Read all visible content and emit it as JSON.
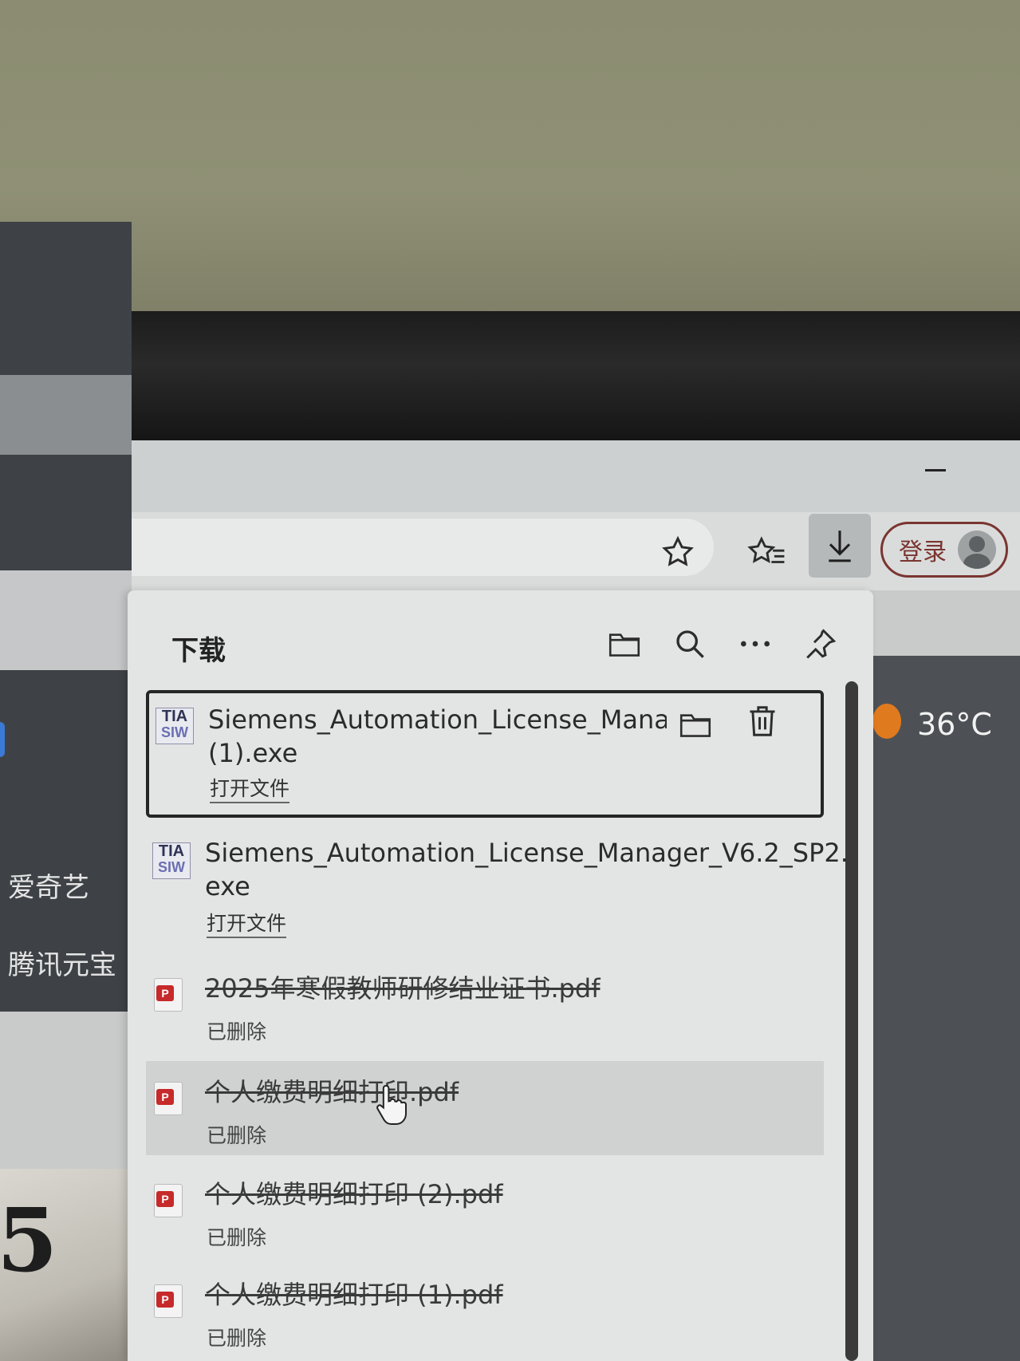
{
  "browser": {
    "login_label": "登录",
    "icons": [
      "star-icon",
      "favorites-list-icon",
      "download-icon",
      "avatar-icon",
      "minimize-icon"
    ]
  },
  "page_background": {
    "side_items": [
      "爱奇艺",
      "腾讯元宝"
    ],
    "weather_temp": "36°C",
    "poster_text": "5"
  },
  "downloads": {
    "title": "下载",
    "header_icons": [
      "folder-icon",
      "search-icon",
      "more-icon",
      "pin-icon"
    ],
    "items": [
      {
        "name_line1": "Siemens_Automation_License_Manager_V",
        "name_line2": "(1).exe",
        "action": "打开文件",
        "icon_top": "TIA",
        "icon_bottom": "SIW",
        "deleted": false,
        "selected": true
      },
      {
        "name_line1": "Siemens_Automation_License_Manager_V6.2_SP2.",
        "name_line2": "exe",
        "action": "打开文件",
        "icon_top": "TIA",
        "icon_bottom": "SIW",
        "deleted": false
      },
      {
        "name_line1": "2025年寒假教师研修结业证书.pdf",
        "status": "已删除",
        "deleted": true
      },
      {
        "name_line1": "个人缴费明细打印.pdf",
        "status": "已删除",
        "deleted": true,
        "hovered": true
      },
      {
        "name_line1": "个人缴费明细打印 (2).pdf",
        "status": "已删除",
        "deleted": true
      },
      {
        "name_line1": "个人缴费明细打印 (1).pdf",
        "status": "已删除",
        "deleted": true
      }
    ]
  },
  "colors": {
    "login_accent": "#7a3530",
    "panel_bg": "#e3e4e4",
    "pdf_red": "#c62a2a",
    "weather_orange": "#e07a1e"
  }
}
